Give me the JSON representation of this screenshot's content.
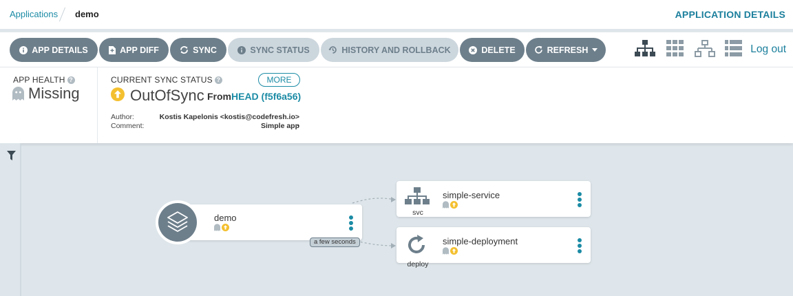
{
  "breadcrumb": {
    "applications": "Applications",
    "current": "demo"
  },
  "header": {
    "title": "APPLICATION DETAILS"
  },
  "toolbar": {
    "app_details": "APP DETAILS",
    "app_diff": "APP DIFF",
    "sync": "SYNC",
    "sync_status": "SYNC STATUS",
    "history": "HISTORY AND ROLLBACK",
    "delete": "DELETE",
    "refresh": "REFRESH",
    "logout": "Log out"
  },
  "status": {
    "health_label": "APP HEALTH",
    "health_value": "Missing",
    "sync_label": "CURRENT SYNC STATUS",
    "more": "MORE",
    "sync_value": "OutOfSync",
    "from": "From",
    "head": "HEAD (f5f6a56)",
    "author_label": "Author:",
    "author_value": "Kostis Kapelonis <kostis@codefresh.io> -",
    "comment_label": "Comment:",
    "comment_value": "Simple app"
  },
  "graph": {
    "app_node": {
      "name": "demo"
    },
    "age_label": "a few seconds",
    "nodes": [
      {
        "name": "simple-service",
        "kind": "svc"
      },
      {
        "name": "simple-deployment",
        "kind": "deploy"
      }
    ]
  },
  "colors": {
    "accent": "#1b8ba5",
    "button": "#6d7f8b",
    "button_disabled": "#ccd6dd",
    "out_of_sync": "#f4c030",
    "missing": "#b0bbc2",
    "canvas": "#dee6eb"
  },
  "icons": {
    "view_modes": [
      "tree-view-icon",
      "pods-view-icon",
      "network-view-icon",
      "list-view-icon"
    ]
  }
}
